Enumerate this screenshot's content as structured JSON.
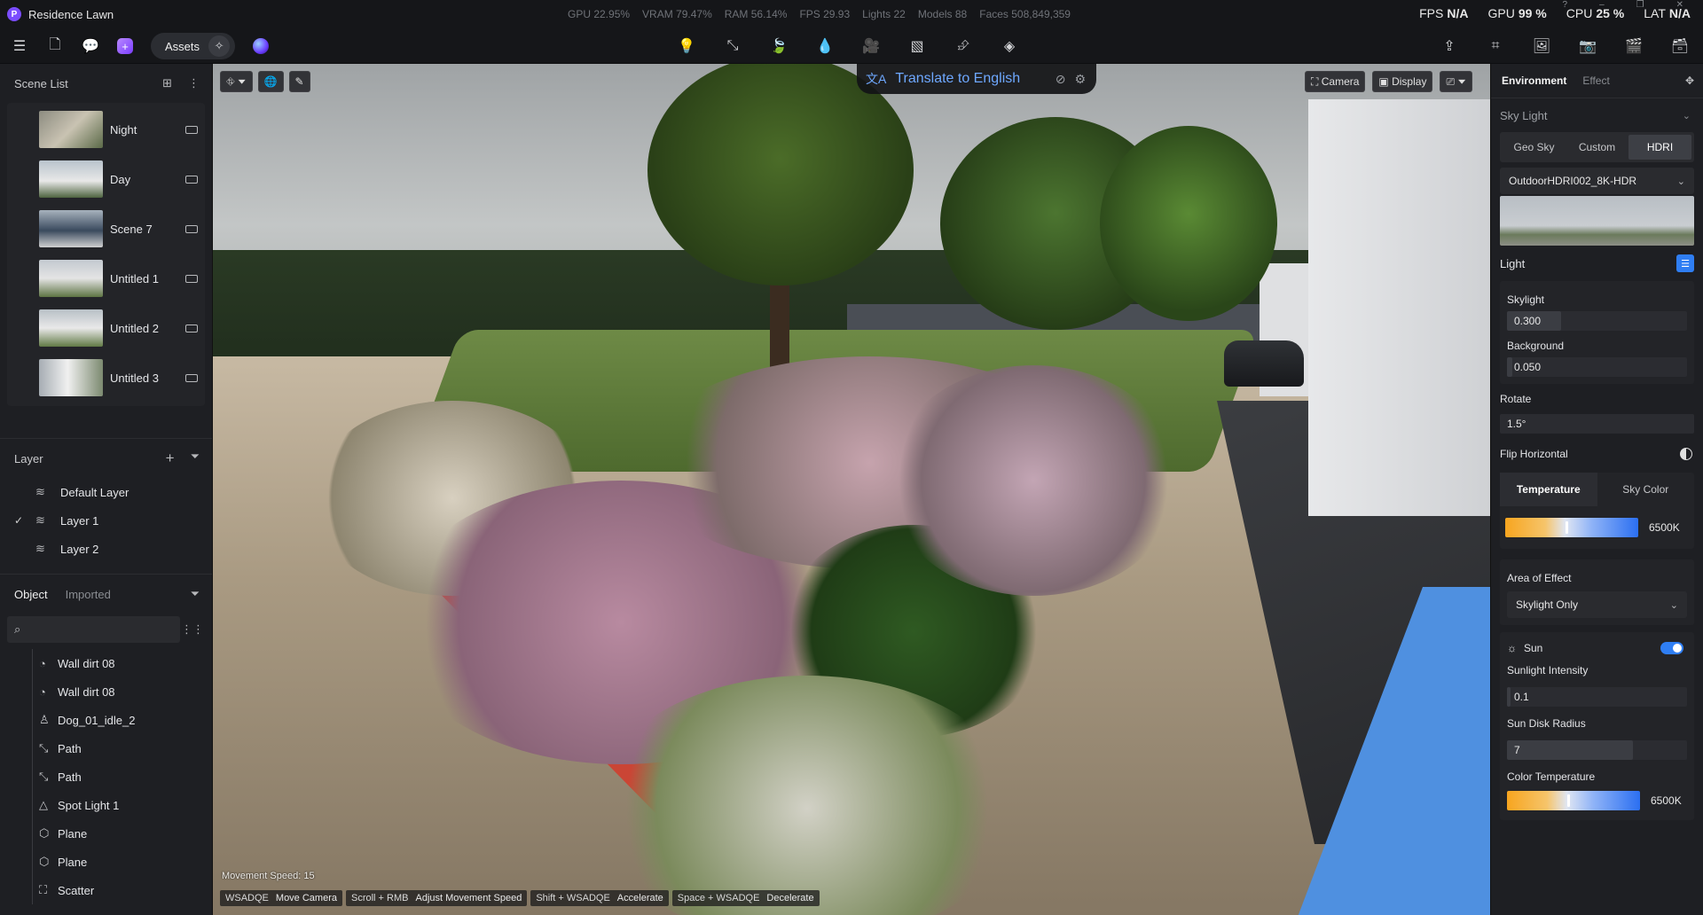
{
  "app": {
    "title": "Residence Lawn"
  },
  "stats": {
    "gpu": "GPU 22.95%",
    "vram": "VRAM 79.47%",
    "ram": "RAM 56.14%",
    "fps": "FPS 29.93",
    "lights": "Lights 22",
    "models": "Models 88",
    "faces": "Faces 508,849,359"
  },
  "perf": {
    "fps_label": "FPS",
    "fps_val": "N/A",
    "gpu_label": "GPU",
    "gpu_val": "99 %",
    "cpu_label": "CPU",
    "cpu_val": "25 %",
    "lat_label": "LAT",
    "lat_val": "N/A"
  },
  "toolbar": {
    "assets_label": "Assets"
  },
  "scene_list": {
    "title": "Scene List",
    "items": [
      {
        "label": "Night"
      },
      {
        "label": "Day"
      },
      {
        "label": "Scene 7"
      },
      {
        "label": "Untitled 1"
      },
      {
        "label": "Untitled 2"
      },
      {
        "label": "Untitled 3"
      }
    ]
  },
  "layers": {
    "title": "Layer",
    "items": [
      {
        "label": "Default Layer"
      },
      {
        "label": "Layer 1"
      },
      {
        "label": "Layer 2"
      }
    ]
  },
  "objects": {
    "tab_object": "Object",
    "tab_imported": "Imported",
    "items": [
      {
        "label": "Wall dirt 08"
      },
      {
        "label": "Wall dirt 08"
      },
      {
        "label": "Dog_01_idle_2"
      },
      {
        "label": "Path"
      },
      {
        "label": "Path"
      },
      {
        "label": "Spot Light 1"
      },
      {
        "label": "Plane"
      },
      {
        "label": "Plane"
      },
      {
        "label": "Scatter"
      }
    ]
  },
  "viewport": {
    "translate_label": "Translate to English",
    "camera_label": "Camera",
    "display_label": "Display",
    "movement_speed": "Movement Speed: 15",
    "hints": [
      {
        "key": "WSADQE",
        "desc": "Move Camera"
      },
      {
        "key": "Scroll + RMB",
        "desc": "Adjust Movement Speed"
      },
      {
        "key": "Shift + WSADQE",
        "desc": "Accelerate"
      },
      {
        "key": "Space + WSADQE",
        "desc": "Decelerate"
      }
    ]
  },
  "right": {
    "tab_environment": "Environment",
    "tab_effect": "Effect",
    "sky_light": "Sky Light",
    "sky_modes": [
      "Geo Sky",
      "Custom",
      "HDRI"
    ],
    "hdri_name": "OutdoorHDRI002_8K-HDR",
    "light_title": "Light",
    "skylight_label": "Skylight",
    "skylight_value": "0.300",
    "background_label": "Background",
    "background_value": "0.050",
    "rotate_label": "Rotate",
    "rotate_value": "1.5°",
    "flip_label": "Flip Horizontal",
    "temp_tab": "Temperature",
    "skycolor_tab": "Sky Color",
    "temp_value": "6500K",
    "area_label": "Area of Effect",
    "area_value": "Skylight Only",
    "sun_label": "Sun",
    "sun_intensity_label": "Sunlight Intensity",
    "sun_intensity_value": "0.1",
    "sun_disk_label": "Sun Disk Radius",
    "sun_disk_value": "7",
    "color_temp_label": "Color Temperature",
    "color_temp_value": "6500K"
  }
}
